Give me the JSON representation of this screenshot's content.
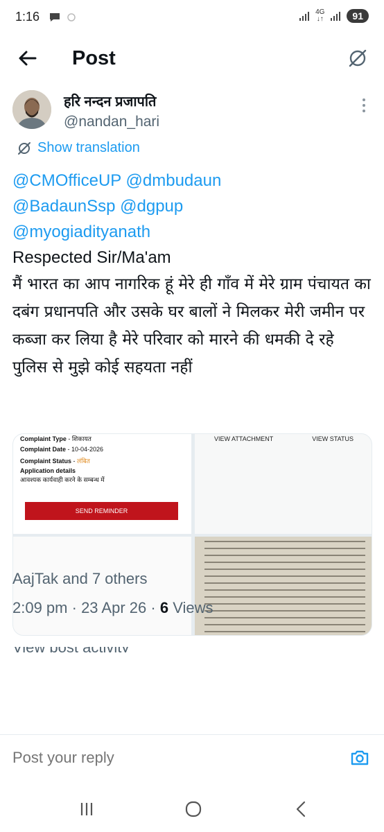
{
  "status_bar": {
    "time": "1:16",
    "network_label": "4G",
    "battery": "91",
    "icons": [
      "chat-bubble-icon",
      "sync-icon",
      "wifi-call-signal-icon",
      "data-arrows-icon",
      "signal-icon"
    ]
  },
  "header": {
    "title": "Post",
    "back_icon": "arrow-left-icon",
    "translate_icon": "translate-off-icon"
  },
  "post": {
    "author": {
      "display_name": "हरि नन्दन प्रजापति",
      "handle": "@nandan_hari"
    },
    "show_translation_label": "Show translation",
    "mentions": [
      "@CMOfficeUP",
      "@dmbudaun",
      "@BadaunSsp",
      "@dgpup",
      "@myogiadityanath"
    ],
    "greeting": "Respected Sir/Ma'am",
    "body": "मैं भारत का आप नागरिक हूं मेरे ही गाँव में मेरे ग्राम पंचायत का दबंग प्रधानपति और उसके घर बालों ने मिलकर मेरी जमीन पर कब्जा कर लिया है मेरे परिवार को मारने की धमकी दे रहे पुलिस से मुझे कोई सहयता नहीं",
    "media": {
      "complaint": {
        "type_label": "Complaint Type",
        "type_value": "शिकायत",
        "date_label": "Complaint Date",
        "date_value": "10-04-2026",
        "status_label": "Complaint Status",
        "status_value": "लंबित",
        "details_label": "Application details",
        "details_value": "आवश्यक कार्यवाही करने के सम्बन्ध में",
        "reminder_button": "SEND REMINDER"
      },
      "view_attachment": "VIEW ATTACHMENT",
      "view_status": "VIEW STATUS"
    },
    "likes_text": "AajTak and 7 others",
    "time": "2:09 pm",
    "date": "23 Apr 26",
    "views_count": "6",
    "views_label": "Views",
    "activity_label": "View post activity"
  },
  "reply": {
    "placeholder": "Post your reply",
    "camera_icon": "camera-icon"
  },
  "nav": {
    "icons": [
      "recents-icon",
      "home-circle-icon",
      "back-chevron-icon"
    ]
  },
  "colors": {
    "accent": "#1d9bf0",
    "text": "#0f1419",
    "muted": "#536471",
    "reminder": "#c0141c"
  }
}
